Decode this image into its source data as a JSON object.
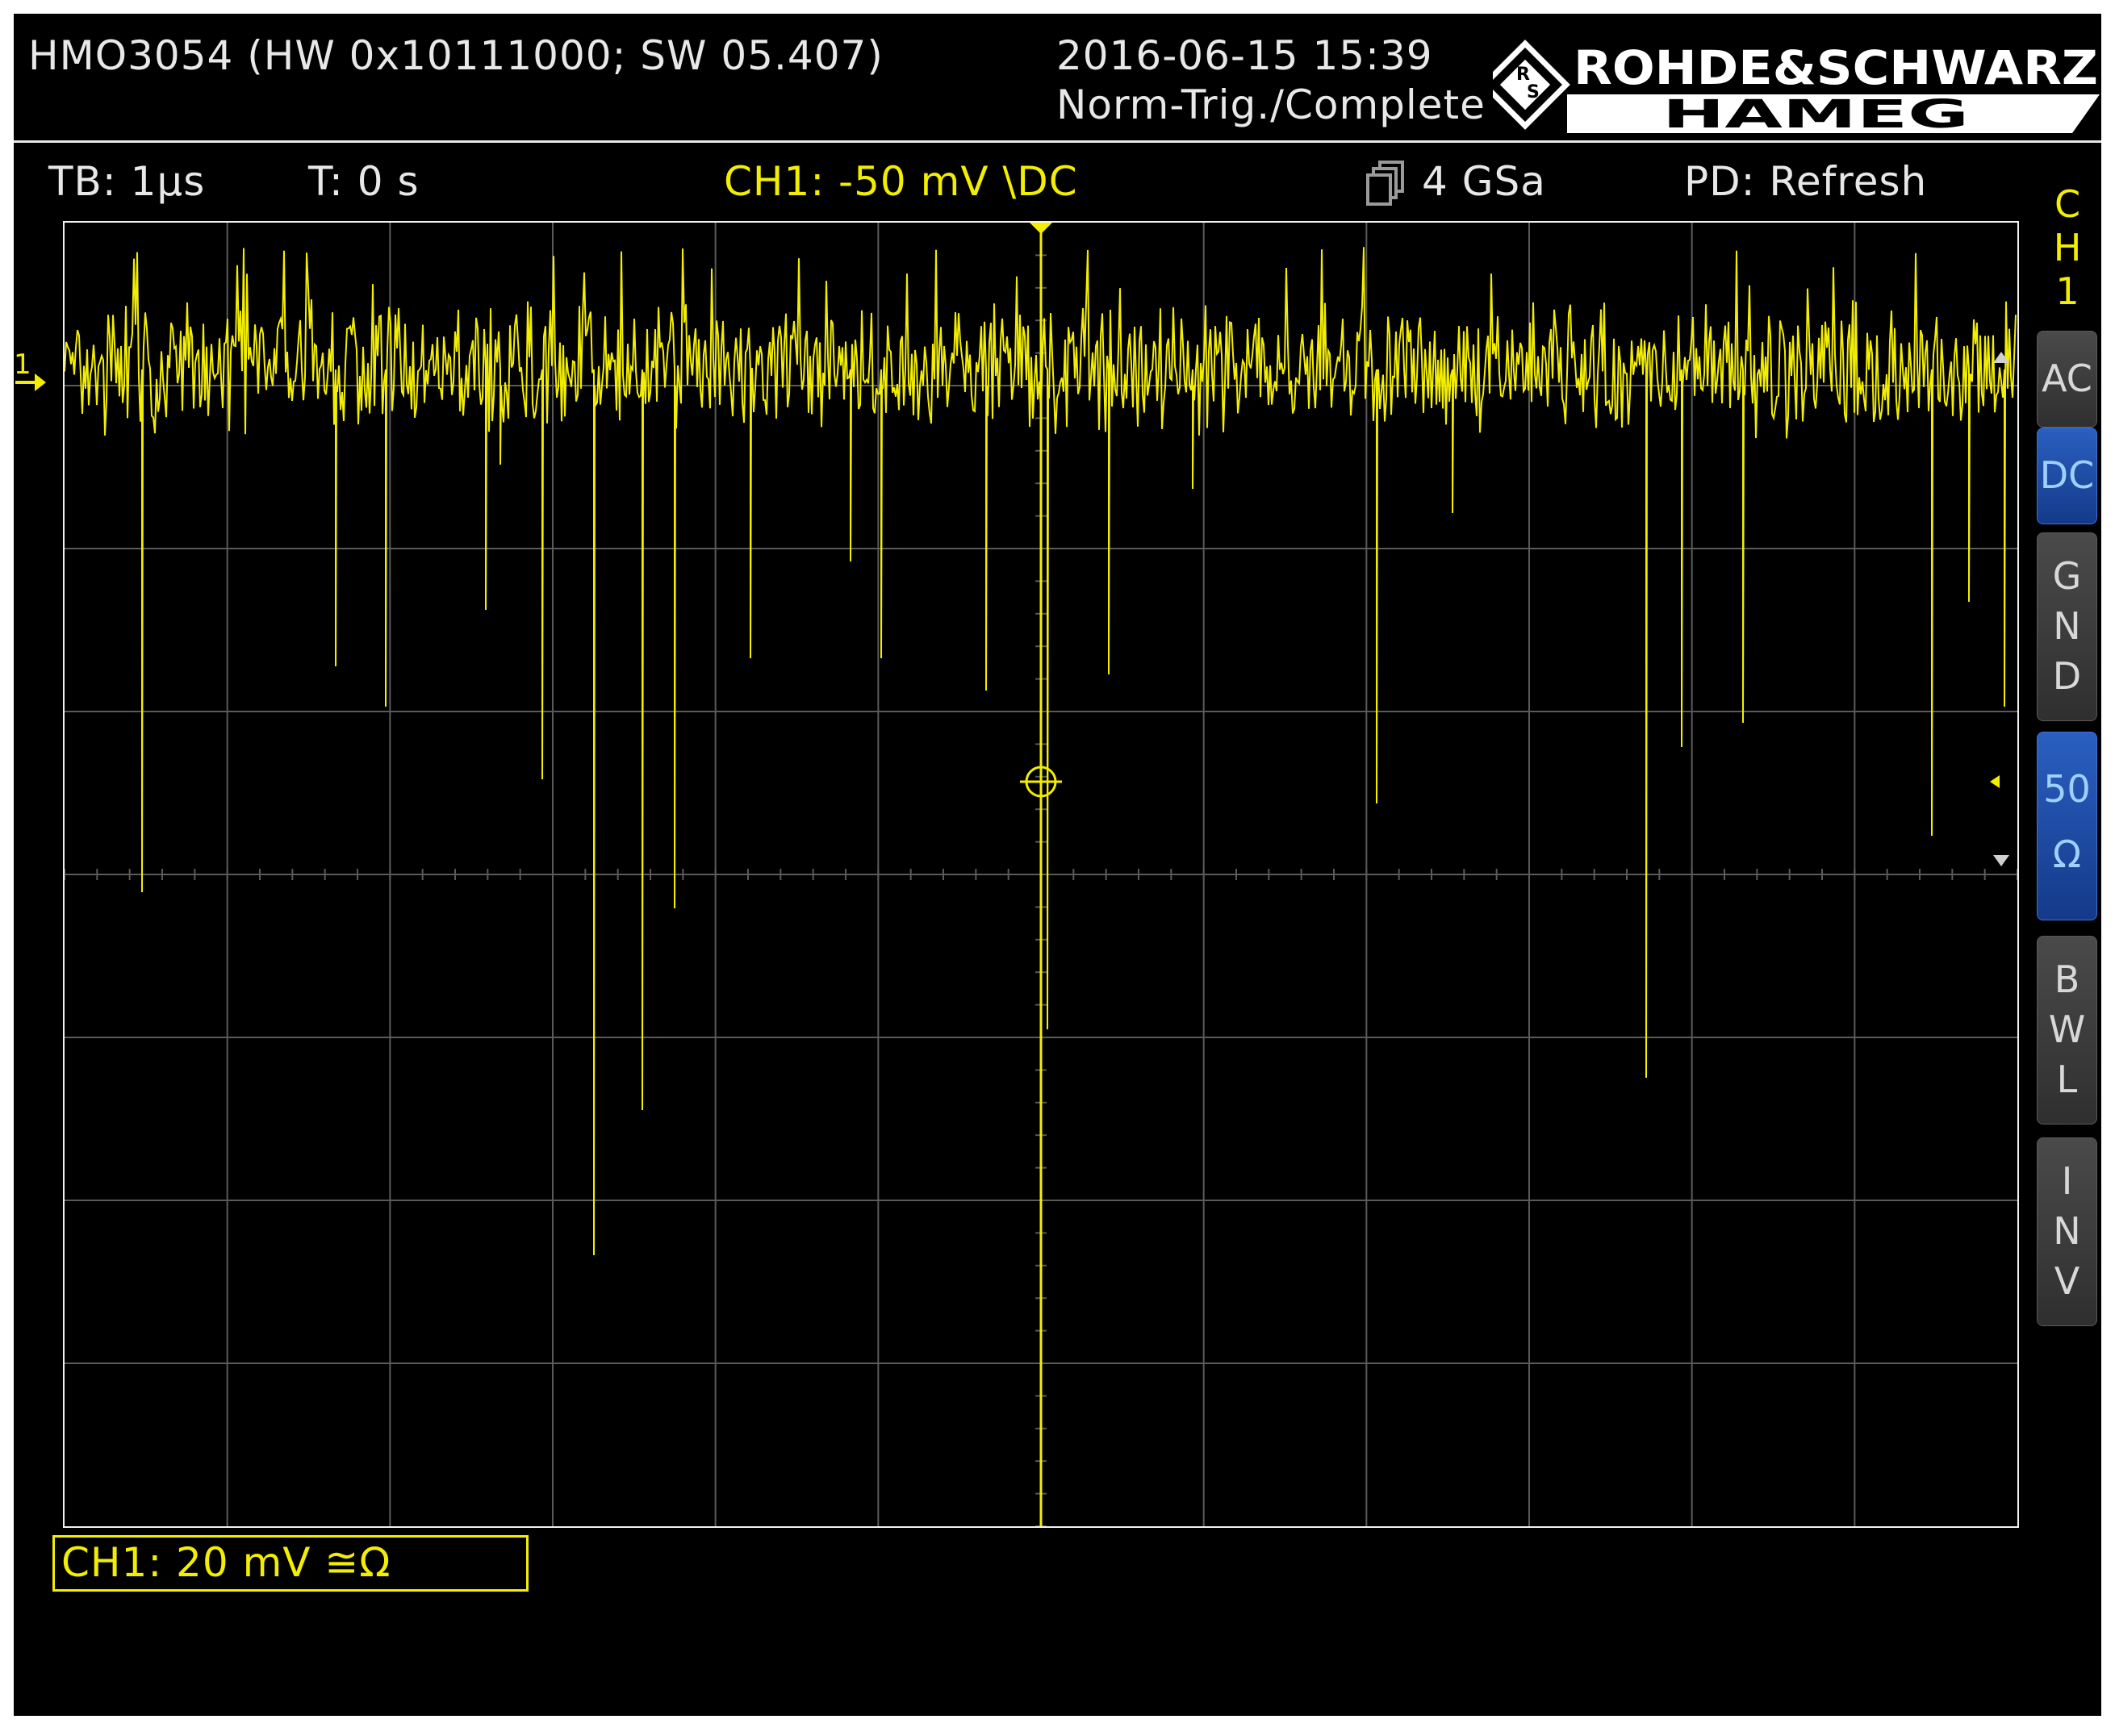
{
  "header": {
    "model_info": "HMO3054 (HW 0x10111000; SW 05.407)",
    "datetime": "2016-06-15 15:39",
    "trigger_status": "Norm-Trig./Complete",
    "brand_top": "ROHDE&SCHWARZ",
    "brand_bottom": "HAMEG"
  },
  "status_bar": {
    "timebase": "TB: 1µs",
    "trigger_time": "T: 0 s",
    "trigger_info": "CH1: -50 mV \\DC",
    "sample_rate": "4 GSa",
    "persistence": "PD: Refresh"
  },
  "channel": {
    "vertical_label": [
      "C",
      "H",
      "1"
    ],
    "marker": "1",
    "scale_label": "CH1: 20 mV ≅Ω",
    "color": "#f3ee00"
  },
  "side_menu": [
    {
      "id": "ac",
      "lines": [
        "AC"
      ],
      "active": false
    },
    {
      "id": "dc",
      "lines": [
        "DC"
      ],
      "active": true
    },
    {
      "id": "gnd",
      "lines": [
        "G",
        "N",
        "D"
      ],
      "active": false
    },
    {
      "id": "50ohm",
      "lines": [
        "50",
        "Ω"
      ],
      "active": true
    },
    {
      "id": "bwl",
      "lines": [
        "B",
        "W",
        "L"
      ],
      "active": false
    },
    {
      "id": "inv",
      "lines": [
        "I",
        "N",
        "V"
      ],
      "active": false
    }
  ],
  "icons": {
    "sample_rate": "acquisition-icon",
    "trigger_level": "trigger-level-marker-icon",
    "trigger_position": "trigger-position-marker-icon",
    "trigger_crosshair": "trigger-crosshair-icon"
  },
  "theme": {
    "background": "#000000",
    "grid": "#5a5a5a",
    "trace": "#f3ee00",
    "active_button": "#1e4fa8"
  }
}
